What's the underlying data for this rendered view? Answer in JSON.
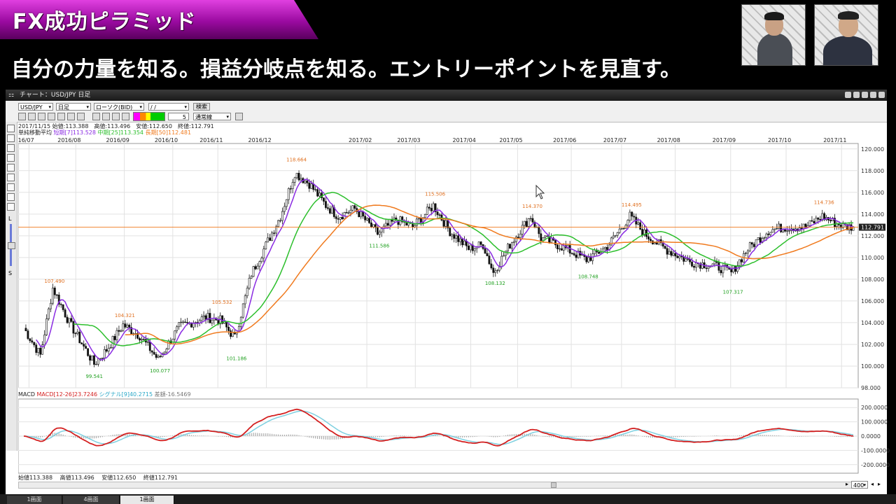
{
  "banner": {
    "title": "FX成功ピラミッド"
  },
  "subtitle": "自分の力量を知る。損益分岐点を知る。エントリーポイントを見直す。",
  "window": {
    "title": "チャート：USD/JPY 日足",
    "symbol": "USD/JPY",
    "timeframe": "日足",
    "price_type": "ローソク(BID)",
    "date_value": "/ /",
    "search_label": "検索",
    "period_value": "5",
    "line_type": "通常線"
  },
  "info": {
    "ohlc": "2017/11/15 始値:113.388　高値:113.496　安値:112.650　終値:112.791",
    "ma_label": "単純移動平均",
    "ma_short": "短期[7]113.528",
    "ma_mid": "中期[25]113.354",
    "ma_long": "長期[50]112.481",
    "macd_label": "MACD",
    "macd_value": "MACD[12-26]23.7246",
    "signal_value": "シグナル[9]40.2715",
    "diff_value": "差額-16.5469"
  },
  "status": {
    "open": "始値113.388",
    "high": "高値113.496",
    "low": "安値112.650",
    "close": "終値112.791",
    "zoom": "400"
  },
  "tabs": [
    {
      "label": "1画面"
    },
    {
      "label": "4画面"
    },
    {
      "label": "1画面"
    }
  ],
  "chart_data": {
    "type": "line",
    "x_ticks": [
      "2016/07",
      "2016/08",
      "2016/09",
      "2016/10",
      "2016/11",
      "2016/12",
      "2017/02",
      "2017/03",
      "2017/04",
      "2017/05",
      "2017/06",
      "2017/07",
      "2017/08",
      "2017/09",
      "2017/10",
      "2017/11"
    ],
    "y_ticks": [
      "120.000",
      "118.000",
      "116.000",
      "114.000",
      "112.000",
      "110.000",
      "108.000",
      "106.000",
      "104.000",
      "102.000",
      "100.000",
      "98.000"
    ],
    "ylim": [
      98,
      120.5
    ],
    "current_price": "112.791",
    "annotations": [
      {
        "text": "107.490",
        "i": 14,
        "price": 107.49,
        "color": "#e07020"
      },
      {
        "text": "99.541",
        "i": 34,
        "price": 99.541,
        "color": "#20a020"
      },
      {
        "text": "104.321",
        "i": 48,
        "price": 104.321,
        "color": "#e07020"
      },
      {
        "text": "100.077",
        "i": 65,
        "price": 100.077,
        "color": "#20a020"
      },
      {
        "text": "105.532",
        "i": 95,
        "price": 105.532,
        "color": "#e07020"
      },
      {
        "text": "101.186",
        "i": 102,
        "price": 101.186,
        "color": "#20a020"
      },
      {
        "text": "118.664",
        "i": 131,
        "price": 118.664,
        "color": "#e07020"
      },
      {
        "text": "111.586",
        "i": 171,
        "price": 111.586,
        "color": "#20a020"
      },
      {
        "text": "115.506",
        "i": 198,
        "price": 115.506,
        "color": "#e07020"
      },
      {
        "text": "108.132",
        "i": 227,
        "price": 108.132,
        "color": "#20a020"
      },
      {
        "text": "114.370",
        "i": 245,
        "price": 114.37,
        "color": "#e07020"
      },
      {
        "text": "108.748",
        "i": 272,
        "price": 108.748,
        "color": "#20a020"
      },
      {
        "text": "114.495",
        "i": 293,
        "price": 114.495,
        "color": "#e07020"
      },
      {
        "text": "107.317",
        "i": 342,
        "price": 107.317,
        "color": "#20a020"
      },
      {
        "text": "114.736",
        "i": 386,
        "price": 114.736,
        "color": "#e07020"
      }
    ],
    "close_keypoints": [
      [
        0,
        103.5
      ],
      [
        8,
        101.0
      ],
      [
        14,
        107.2
      ],
      [
        22,
        104.0
      ],
      [
        34,
        100.2
      ],
      [
        40,
        101.5
      ],
      [
        48,
        103.8
      ],
      [
        56,
        102.8
      ],
      [
        65,
        100.6
      ],
      [
        75,
        103.6
      ],
      [
        88,
        104.5
      ],
      [
        95,
        104.2
      ],
      [
        102,
        102.6
      ],
      [
        110,
        108.5
      ],
      [
        118,
        111.5
      ],
      [
        124,
        113.8
      ],
      [
        131,
        117.8
      ],
      [
        138,
        116.8
      ],
      [
        146,
        114.8
      ],
      [
        152,
        113.8
      ],
      [
        160,
        114.5
      ],
      [
        171,
        112.2
      ],
      [
        180,
        113.5
      ],
      [
        188,
        112.8
      ],
      [
        198,
        114.8
      ],
      [
        206,
        112.4
      ],
      [
        215,
        110.8
      ],
      [
        222,
        111.2
      ],
      [
        227,
        108.6
      ],
      [
        235,
        111.2
      ],
      [
        245,
        113.8
      ],
      [
        250,
        111.8
      ],
      [
        260,
        111.0
      ],
      [
        272,
        109.8
      ],
      [
        282,
        111.0
      ],
      [
        293,
        113.8
      ],
      [
        300,
        112.2
      ],
      [
        310,
        110.8
      ],
      [
        322,
        109.6
      ],
      [
        335,
        109.2
      ],
      [
        342,
        108.6
      ],
      [
        350,
        110.8
      ],
      [
        360,
        112.5
      ],
      [
        368,
        112.8
      ],
      [
        378,
        112.8
      ],
      [
        386,
        113.8
      ],
      [
        392,
        113.2
      ],
      [
        398,
        112.8
      ]
    ],
    "series": [
      {
        "name": "短期[7]",
        "color": "#8a2be2"
      },
      {
        "name": "中期[25]",
        "color": "#2cbf2c"
      },
      {
        "name": "長期[50]",
        "color": "#f07a1e"
      }
    ],
    "macd": {
      "y_ticks": [
        "200.0000",
        "100.0000",
        "0.0000",
        "-100.0000",
        "-200.0000"
      ],
      "ylim": [
        -260,
        260
      ],
      "macd_color": "#d42020",
      "signal_color": "#7fd0e0"
    }
  }
}
